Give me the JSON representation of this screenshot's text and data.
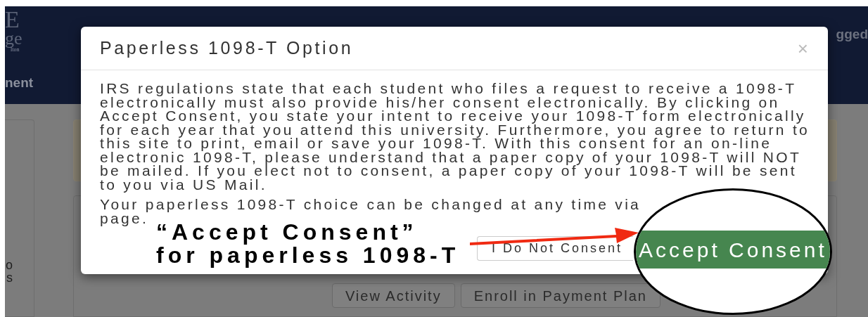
{
  "background": {
    "logo_lines": [
      "E",
      "ge",
      "lton"
    ],
    "nav_item": "nent",
    "user_text": "gged",
    "sidebar_lines": [
      "o",
      "s"
    ],
    "buttons": [
      {
        "label": "View Activity",
        "kind": "default"
      },
      {
        "label": "Enroll in Payment Plan",
        "kind": "default"
      }
    ]
  },
  "dialog": {
    "title": "Paperless 1098-T Option",
    "close": "×",
    "paragraph": "IRS regulations state that each student who files a request to receive a 1098-T electronically must also provide his/her consent electronically. By clicking on Accept Consent, you state your intent to receive your 1098-T form electronically for each year that you attend this university. Furthermore, you agree to return to this site to print, email or save your 1098-T. With this consent for an on-line electronic 1098-T, please understand that a paper copy of your 1098-T will NOT be mailed. If you elect not to consent, a paper copy of your 1098-T will be sent to you via US Mail.",
    "choice_line": "Your paperless 1098-T choice can be changed at any time via",
    "choice_end": "page.",
    "buttons": [
      {
        "label": "I Do Not Consent",
        "kind": "default"
      }
    ]
  },
  "annotation": {
    "caption_lines": [
      "“Accept Consent”",
      "for paperless 1098-T"
    ],
    "magnified_button": "Accept Consent"
  }
}
